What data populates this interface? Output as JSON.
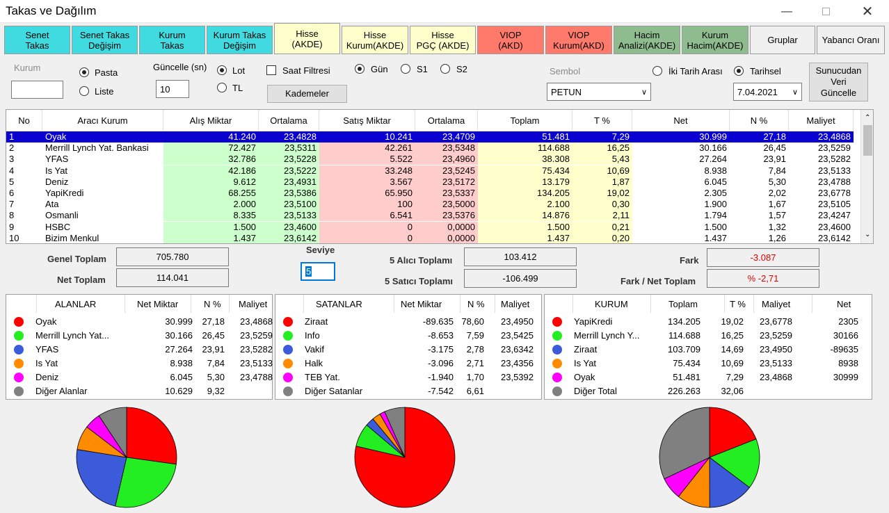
{
  "window": {
    "title": "Takas ve Dağılım"
  },
  "tabs": [
    {
      "label": "Senet\nTakas",
      "color": "#3fdbe0"
    },
    {
      "label": "Senet Takas\nDeğişim",
      "color": "#3fdbe0"
    },
    {
      "label": "Kurum\nTakas",
      "color": "#3fdbe0"
    },
    {
      "label": "Kurum Takas\nDeğişim",
      "color": "#3fdbe0"
    },
    {
      "label": "Hisse\n(AKDE)",
      "color": "#ffffcc"
    },
    {
      "label": "Hisse\nKurum(AKDE)",
      "color": "#ffffcc"
    },
    {
      "label": "Hisse\nPGÇ (AKDE)",
      "color": "#ffffcc"
    },
    {
      "label": "VIOP\n(AKD)",
      "color": "#ff7a6b"
    },
    {
      "label": "VIOP\nKurum(AKD)",
      "color": "#ff7a6b"
    },
    {
      "label": "Hacim\nAnalizi(AKDE)",
      "color": "#8fbc8f"
    },
    {
      "label": "Kurum\nHacim(AKDE)",
      "color": "#8fbc8f"
    },
    {
      "label": "Gruplar",
      "color": "#f0f0f0"
    },
    {
      "label": "Yabancı Oranı",
      "color": "#f0f0f0"
    }
  ],
  "controls": {
    "kurum_label": "Kurum",
    "kurum_value": "",
    "pasta_label": "Pasta",
    "liste_label": "Liste",
    "guncelle_label": "Güncelle (sn)",
    "guncelle_value": "10",
    "lot_label": "Lot",
    "tl_label": "TL",
    "saat_filtresi_label": "Saat Filtresi",
    "kademeler_label": "Kademeler",
    "gun_label": "Gün",
    "s1_label": "S1",
    "s2_label": "S2",
    "sembol_label": "Sembol",
    "sembol_value": "PETUN",
    "iki_tarih_label": "İki Tarih Arası",
    "tarihsel_label": "Tarihsel",
    "date_value": "7.04.2021",
    "sunucu_button": "Sunucudan\nVeri\nGüncelle"
  },
  "table": {
    "headers": [
      "No",
      "Aracı Kurum",
      "Alış Miktar",
      "Ortalama",
      "Satış Miktar",
      "Ortalama",
      "Toplam",
      "T %",
      "Net",
      "N %",
      "Maliyet"
    ],
    "rows": [
      [
        "1",
        "Oyak",
        "41.240",
        "23,4828",
        "10.241",
        "23,4709",
        "51.481",
        "7,29",
        "30.999",
        "27,18",
        "23,4868"
      ],
      [
        "2",
        "Merrill Lynch Yat. Bankasi",
        "72.427",
        "23,5311",
        "42.261",
        "23,5348",
        "114.688",
        "16,25",
        "30.166",
        "26,45",
        "23,5259"
      ],
      [
        "3",
        "YFAS",
        "32.786",
        "23,5228",
        "5.522",
        "23,4960",
        "38.308",
        "5,43",
        "27.264",
        "23,91",
        "23,5282"
      ],
      [
        "4",
        "Is Yat",
        "42.186",
        "23,5222",
        "33.248",
        "23,5245",
        "75.434",
        "10,69",
        "8.938",
        "7,84",
        "23,5133"
      ],
      [
        "5",
        "Deniz",
        "9.612",
        "23,4931",
        "3.567",
        "23,5172",
        "13.179",
        "1,87",
        "6.045",
        "5,30",
        "23,4788"
      ],
      [
        "6",
        "YapiKredi",
        "68.255",
        "23,5386",
        "65.950",
        "23,5337",
        "134.205",
        "19,02",
        "2.305",
        "2,02",
        "23,6778"
      ],
      [
        "7",
        "Ata",
        "2.000",
        "23,5100",
        "100",
        "23,5000",
        "2.100",
        "0,30",
        "1.900",
        "1,67",
        "23,5105"
      ],
      [
        "8",
        "Osmanli",
        "8.335",
        "23,5133",
        "6.541",
        "23,5376",
        "14.876",
        "2,11",
        "1.794",
        "1,57",
        "23,4247"
      ],
      [
        "9",
        "HSBC",
        "1.500",
        "23,4600",
        "0",
        "0,0000",
        "1.500",
        "0,21",
        "1.500",
        "1,32",
        "23,4600"
      ],
      [
        "10",
        "Bizim Menkul",
        "1.437",
        "23,6142",
        "0",
        "0,0000",
        "1.437",
        "0,20",
        "1.437",
        "1,26",
        "23,6142"
      ]
    ],
    "colors": {
      "buy": "#ccffcc",
      "sell": "#ffcccc",
      "total": "#ffffcc",
      "selected": "#0a00d0"
    }
  },
  "summary": {
    "genel_toplam_label": "Genel Toplam",
    "genel_toplam_value": "705.780",
    "net_toplam_label": "Net Toplam",
    "net_toplam_value": "114.041",
    "seviye_label": "Seviye",
    "seviye_value": "5",
    "alici_label": "5  Alıcı Toplamı",
    "alici_value": "103.412",
    "satici_label": "5  Satıcı Toplamı",
    "satici_value": "-106.499",
    "fark_label": "Fark",
    "fark_value": "-3.087",
    "fark_net_label": "Fark / Net Toplam",
    "fark_net_value": "% -2,71"
  },
  "panels": {
    "alanlar": {
      "headers": [
        "ALANLAR",
        "Net Miktar",
        "N %",
        "Maliyet"
      ],
      "rows": [
        {
          "name": "Oyak",
          "v1": "30.999",
          "v2": "27,18",
          "v3": "23,4868",
          "color": "#ff0000"
        },
        {
          "name": "Merrill Lynch Yat...",
          "v1": "30.166",
          "v2": "26,45",
          "v3": "23,5259",
          "color": "#22ee22"
        },
        {
          "name": "YFAS",
          "v1": "27.264",
          "v2": "23,91",
          "v3": "23,5282",
          "color": "#3b5bdb"
        },
        {
          "name": "Is Yat",
          "v1": "8.938",
          "v2": "7,84",
          "v3": "23,5133",
          "color": "#ff8c00"
        },
        {
          "name": "Deniz",
          "v1": "6.045",
          "v2": "5,30",
          "v3": "23,4788",
          "color": "#ff00ff"
        },
        {
          "name": "Diğer Alanlar",
          "v1": "10.629",
          "v2": "9,32",
          "v3": "",
          "color": "#808080"
        }
      ],
      "pie": [
        27.18,
        26.45,
        23.91,
        7.84,
        5.3,
        9.32
      ]
    },
    "satanlar": {
      "headers": [
        "SATANLAR",
        "Net Miktar",
        "N %",
        "Maliyet"
      ],
      "rows": [
        {
          "name": "Ziraat",
          "v1": "-89.635",
          "v2": "78,60",
          "v3": "23,4950",
          "color": "#ff0000"
        },
        {
          "name": "Info",
          "v1": "-8.653",
          "v2": "7,59",
          "v3": "23,5425",
          "color": "#22ee22"
        },
        {
          "name": "Vakif",
          "v1": "-3.175",
          "v2": "2,78",
          "v3": "23,6342",
          "color": "#3b5bdb"
        },
        {
          "name": "Halk",
          "v1": "-3.096",
          "v2": "2,71",
          "v3": "23,4356",
          "color": "#ff8c00"
        },
        {
          "name": "TEB Yat.",
          "v1": "-1.940",
          "v2": "1,70",
          "v3": "23,5392",
          "color": "#ff00ff"
        },
        {
          "name": "Diğer Satanlar",
          "v1": "-7.542",
          "v2": "6,61",
          "v3": "",
          "color": "#808080"
        }
      ],
      "pie": [
        78.6,
        7.59,
        2.78,
        2.71,
        1.7,
        6.61
      ]
    },
    "kurum": {
      "headers": [
        "KURUM",
        "Toplam",
        "T %",
        "Maliyet",
        "Net"
      ],
      "rows": [
        {
          "name": "YapiKredi",
          "v1": "134.205",
          "v2": "19,02",
          "v3": "23,6778",
          "v4": "2305",
          "color": "#ff0000"
        },
        {
          "name": "Merrill Lynch Y...",
          "v1": "114.688",
          "v2": "16,25",
          "v3": "23,5259",
          "v4": "30166",
          "color": "#22ee22"
        },
        {
          "name": "Ziraat",
          "v1": "103.709",
          "v2": "14,69",
          "v3": "23,4950",
          "v4": "-89635",
          "color": "#3b5bdb"
        },
        {
          "name": "Is Yat",
          "v1": "75.434",
          "v2": "10,69",
          "v3": "23,5133",
          "v4": "8938",
          "color": "#ff8c00"
        },
        {
          "name": "Oyak",
          "v1": "51.481",
          "v2": "7,29",
          "v3": "23,4868",
          "v4": "30999",
          "color": "#ff00ff"
        },
        {
          "name": "Diğer Total",
          "v1": "226.263",
          "v2": "32,06",
          "v3": "",
          "v4": "",
          "color": "#808080"
        }
      ],
      "pie": [
        19.02,
        16.25,
        14.69,
        10.69,
        7.29,
        32.06
      ]
    }
  }
}
